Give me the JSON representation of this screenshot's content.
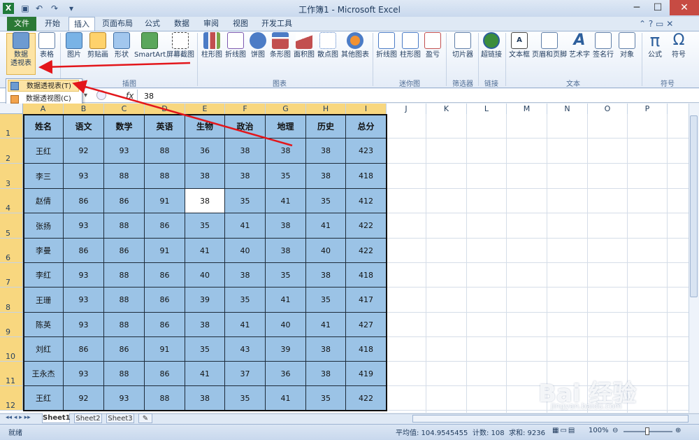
{
  "window": {
    "title": "工作簿1 - Microsoft Excel",
    "app_icon": "X"
  },
  "quick_access": [
    "save-icon",
    "undo-icon",
    "redo-icon",
    "customize-icon"
  ],
  "tabs": [
    "文件",
    "开始",
    "插入",
    "页面布局",
    "公式",
    "数据",
    "审阅",
    "视图",
    "开发工具"
  ],
  "ribbon": {
    "buttons": [
      "数据\n透视表",
      "表格",
      "图片",
      "剪贴画",
      "形状",
      "SmartArt",
      "屏幕截图",
      "柱形图",
      "折线图",
      "饼图",
      "条形图",
      "面积图",
      "散点图",
      "其他图表",
      "折线图",
      "柱形图",
      "盈亏",
      "切片器",
      "超链接",
      "文本框",
      "页眉和页脚",
      "艺术字",
      "签名行",
      "对象",
      "公式",
      "符号"
    ],
    "group_labels": [
      "插图",
      "图表",
      "迷你图",
      "筛选器",
      "链接",
      "文本",
      "符号"
    ]
  },
  "dropdown": {
    "items": [
      "数据透视表(T)",
      "数据透视图(C)"
    ]
  },
  "formula_bar": {
    "fx": "fx",
    "value": "38"
  },
  "columns": [
    "A",
    "B",
    "C",
    "D",
    "E",
    "F",
    "G",
    "H",
    "I",
    "J",
    "K",
    "L",
    "M",
    "N",
    "O",
    "P"
  ],
  "rows": [
    "1",
    "2",
    "3",
    "4",
    "5",
    "6",
    "7",
    "8",
    "9",
    "10",
    "11",
    "12"
  ],
  "table": {
    "headers": [
      "姓名",
      "语文",
      "数学",
      "英语",
      "生物",
      "政治",
      "地理",
      "历史",
      "总分"
    ],
    "rows": [
      [
        "王红",
        "92",
        "93",
        "88",
        "36",
        "38",
        "38",
        "38",
        "423"
      ],
      [
        "李三",
        "93",
        "88",
        "88",
        "38",
        "38",
        "35",
        "38",
        "418"
      ],
      [
        "赵倩",
        "86",
        "86",
        "91",
        "38",
        "35",
        "41",
        "35",
        "412"
      ],
      [
        "张扬",
        "93",
        "88",
        "86",
        "35",
        "41",
        "38",
        "41",
        "422"
      ],
      [
        "李曼",
        "86",
        "86",
        "91",
        "41",
        "40",
        "38",
        "40",
        "422"
      ],
      [
        "李红",
        "93",
        "88",
        "86",
        "40",
        "38",
        "35",
        "38",
        "418"
      ],
      [
        "王珊",
        "93",
        "88",
        "86",
        "39",
        "35",
        "41",
        "35",
        "417"
      ],
      [
        "陈英",
        "93",
        "88",
        "86",
        "38",
        "41",
        "40",
        "41",
        "427"
      ],
      [
        "刘红",
        "86",
        "86",
        "91",
        "35",
        "43",
        "39",
        "38",
        "418"
      ],
      [
        "王永杰",
        "93",
        "88",
        "86",
        "41",
        "37",
        "36",
        "38",
        "419"
      ],
      [
        "王红",
        "92",
        "93",
        "88",
        "38",
        "35",
        "41",
        "35",
        "422"
      ]
    ]
  },
  "sheets": [
    "Sheet1",
    "Sheet2",
    "Sheet3"
  ],
  "status": {
    "ready": "就绪",
    "average": "平均值: 104.9545455",
    "count": "计数: 108",
    "sum": "求和: 9236",
    "zoom": "100%"
  },
  "watermark": {
    "brand": "Bai 经验",
    "url": "jingyan.baidu.com"
  },
  "colors": {
    "file_tab": "#2b7935",
    "table_fill": "#9bc3e6",
    "selection": "#f8d77f",
    "arrow": "#e3161b"
  }
}
